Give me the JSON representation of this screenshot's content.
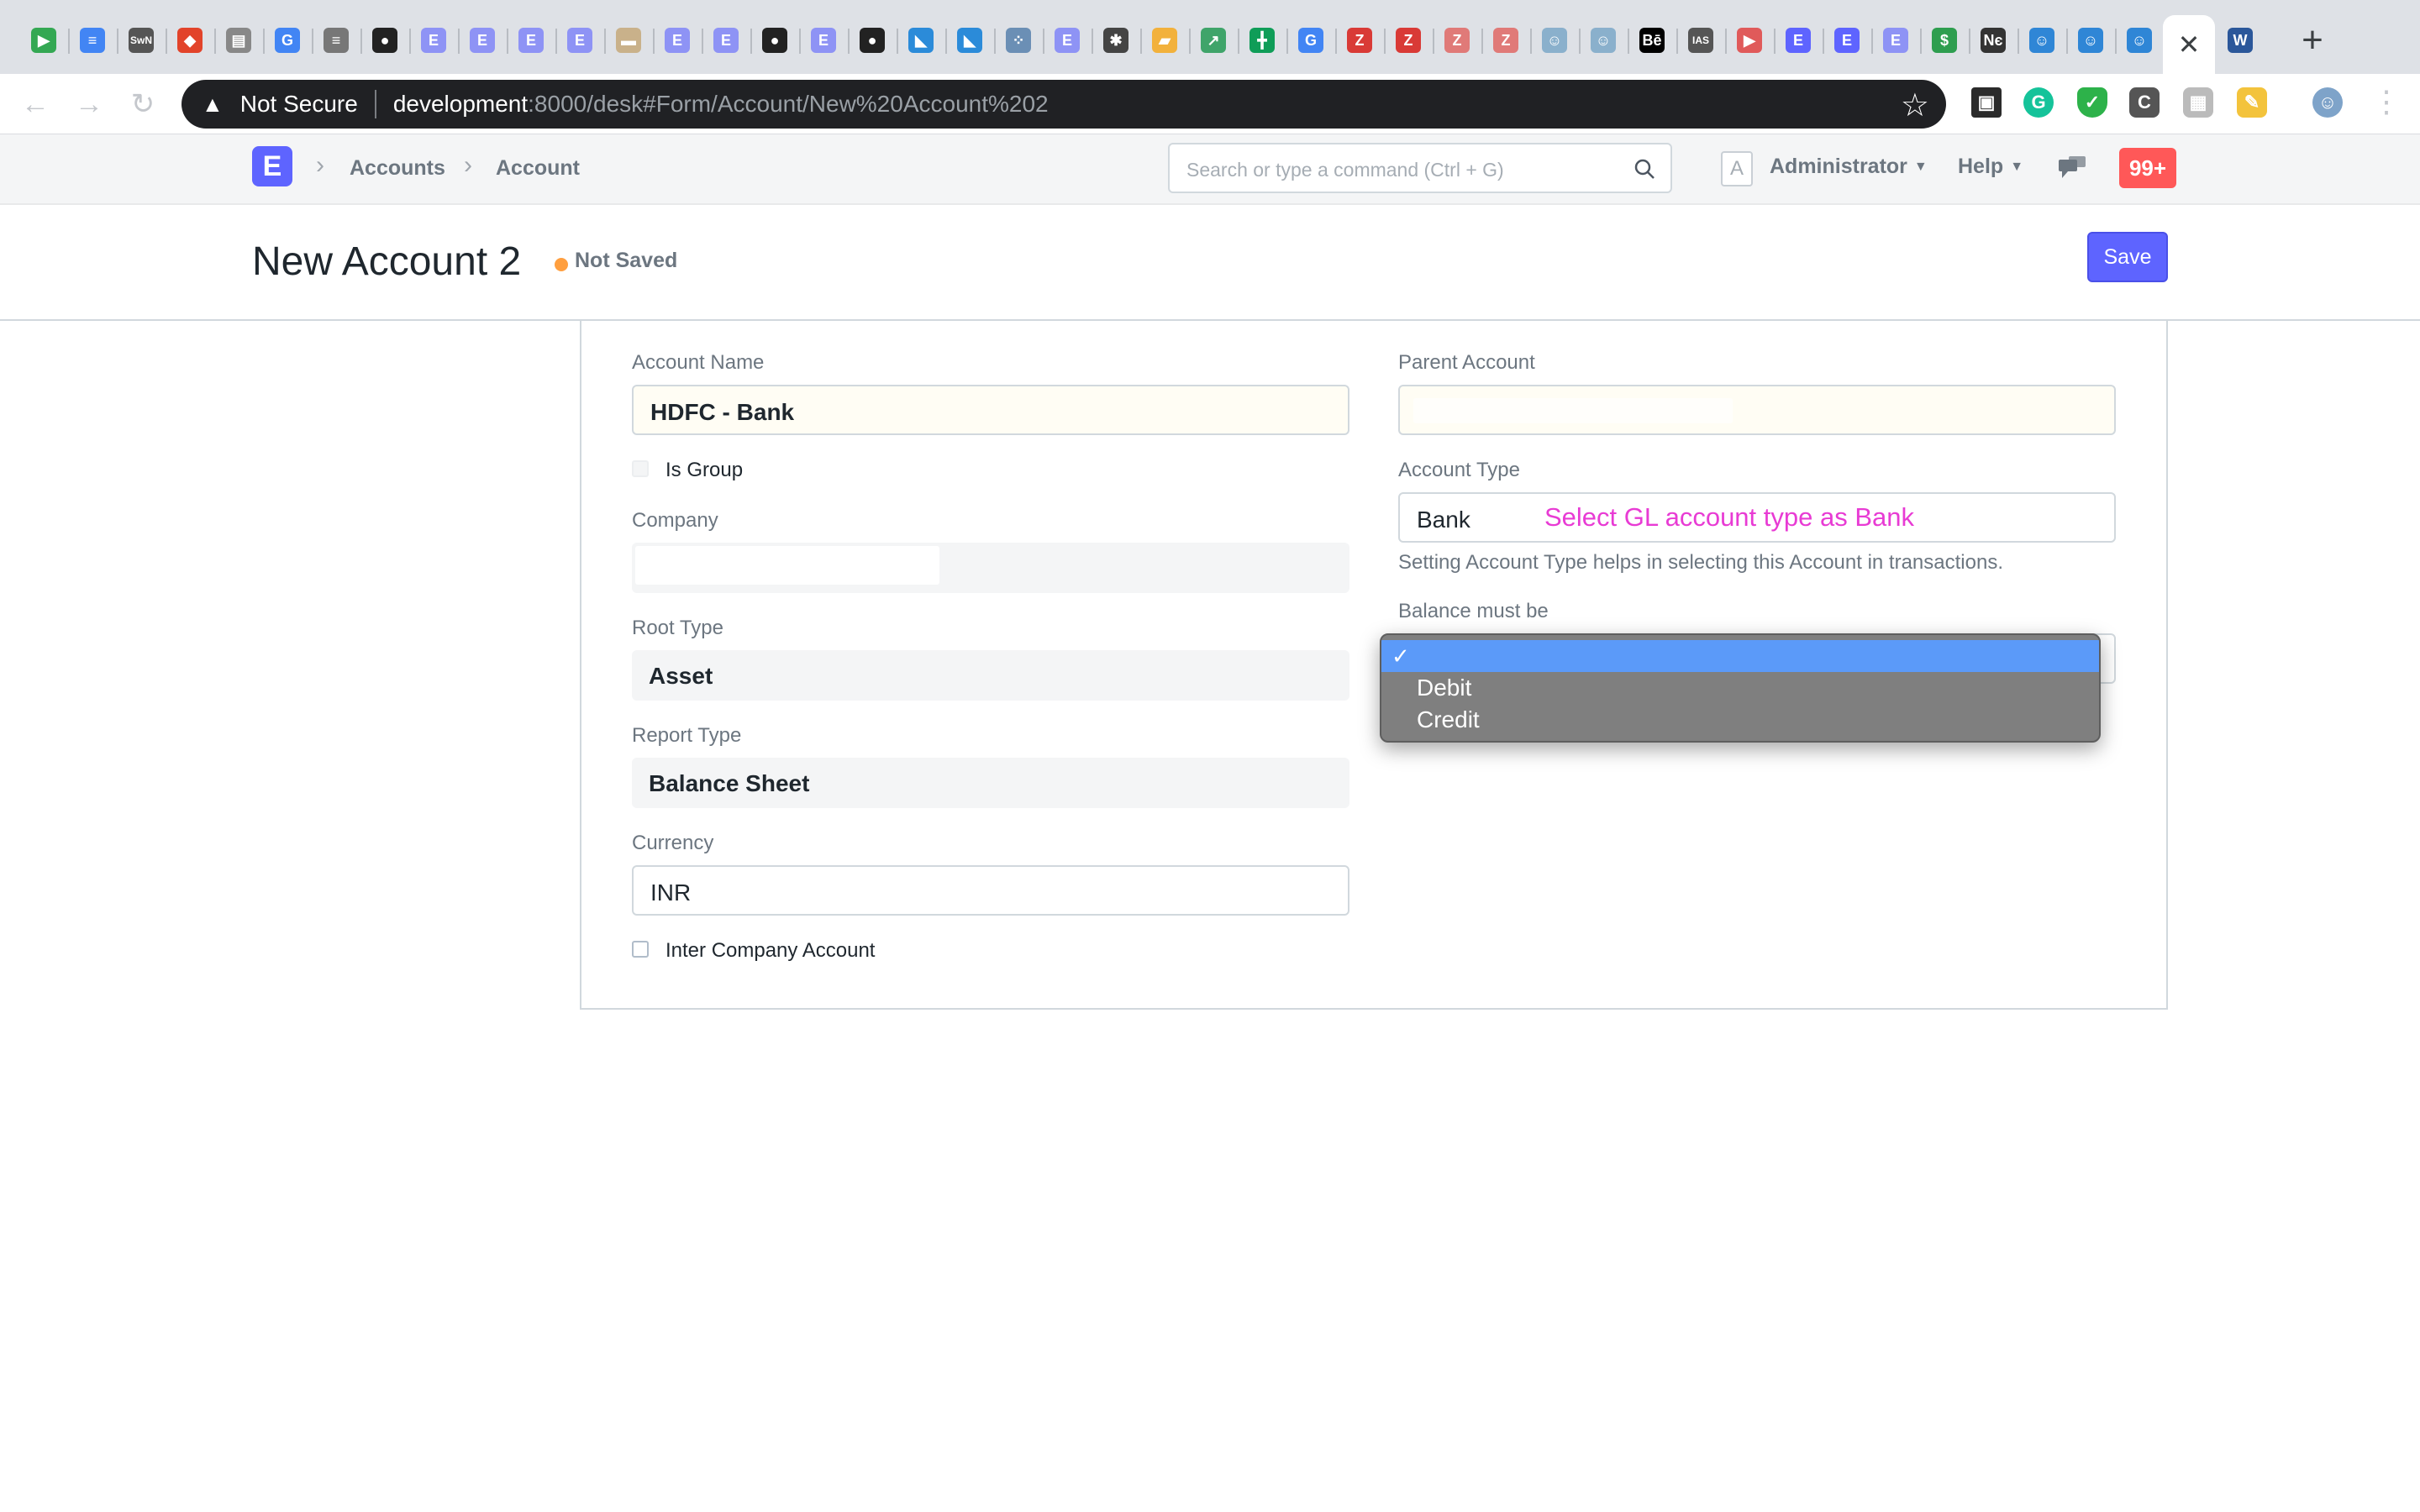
{
  "browser": {
    "active_tab_close": "✕",
    "new_tab": "+",
    "security_label": "Not Secure",
    "url_host": "development",
    "url_rest": ":8000/desk#Form/Account/New%20Account%202",
    "tabs": [
      {
        "icon": "play-store-icon",
        "glyph": "▶",
        "color": "#34a853"
      },
      {
        "icon": "docs-icon",
        "glyph": "≡",
        "color": "#4285f4"
      },
      {
        "icon": "swn-icon",
        "glyph": "SwN",
        "color": "#555555"
      },
      {
        "icon": "gitlab-icon",
        "glyph": "◆",
        "color": "#e2432a"
      },
      {
        "icon": "reader-icon",
        "glyph": "▤",
        "color": "#888888"
      },
      {
        "icon": "google-icon",
        "glyph": "G",
        "color": "#4285f4"
      },
      {
        "icon": "calc-icon",
        "glyph": "≡",
        "color": "#777777"
      },
      {
        "icon": "github-icon",
        "glyph": "●",
        "color": "#222222"
      },
      {
        "icon": "erpnext-icon",
        "glyph": "E",
        "color": "#8e93f5"
      },
      {
        "icon": "erpnext-icon",
        "glyph": "E",
        "color": "#8e93f5"
      },
      {
        "icon": "erpnext-icon",
        "glyph": "E",
        "color": "#8e93f5"
      },
      {
        "icon": "erpnext-icon",
        "glyph": "E",
        "color": "#8e93f5"
      },
      {
        "icon": "pdf-icon",
        "glyph": "▬",
        "color": "#c9b18a"
      },
      {
        "icon": "erpnext-icon",
        "glyph": "E",
        "color": "#8e93f5"
      },
      {
        "icon": "erpnext-icon",
        "glyph": "E",
        "color": "#8e93f5"
      },
      {
        "icon": "github-icon",
        "glyph": "●",
        "color": "#222222"
      },
      {
        "icon": "erpnext-icon",
        "glyph": "E",
        "color": "#8e93f5"
      },
      {
        "icon": "github-icon",
        "glyph": "●",
        "color": "#222222"
      },
      {
        "icon": "vscode-icon",
        "glyph": "◣",
        "color": "#2b8bd9"
      },
      {
        "icon": "vscode-icon",
        "glyph": "◣",
        "color": "#2b8bd9"
      },
      {
        "icon": "dots-icon",
        "glyph": "⁘",
        "color": "#6b8fb5"
      },
      {
        "icon": "erpnext-icon",
        "glyph": "E",
        "color": "#8e93f5"
      },
      {
        "icon": "puzzle-icon",
        "glyph": "✱",
        "color": "#444444"
      },
      {
        "icon": "slides-icon",
        "glyph": "▰",
        "color": "#f2b13c"
      },
      {
        "icon": "chart-icon",
        "glyph": "↗",
        "color": "#3fa46a"
      },
      {
        "icon": "sheets-icon",
        "glyph": "╋",
        "color": "#0f9d58"
      },
      {
        "icon": "google-icon",
        "glyph": "G",
        "color": "#4285f4"
      },
      {
        "icon": "zotero-icon",
        "glyph": "Z",
        "color": "#d93a36"
      },
      {
        "icon": "zotero-icon",
        "glyph": "Z",
        "color": "#d93a36"
      },
      {
        "icon": "zotero-icon",
        "glyph": "Z",
        "color": "#e07a78"
      },
      {
        "icon": "zotero-icon",
        "glyph": "Z",
        "color": "#e07a78"
      },
      {
        "icon": "octocat-icon",
        "glyph": "☺",
        "color": "#8ab0cc"
      },
      {
        "icon": "octocat-icon",
        "glyph": "☺",
        "color": "#8ab0cc"
      },
      {
        "icon": "behance-icon",
        "glyph": "Bē",
        "color": "#000000"
      },
      {
        "icon": "ias-icon",
        "glyph": "IAS",
        "color": "#555555"
      },
      {
        "icon": "youtube-icon",
        "glyph": "▶",
        "color": "#e05a5a"
      },
      {
        "icon": "erpnext-icon",
        "glyph": "E",
        "color": "#5e64ff"
      },
      {
        "icon": "erpnext-icon",
        "glyph": "E",
        "color": "#5e64ff"
      },
      {
        "icon": "erpnext-icon",
        "glyph": "E",
        "color": "#8e93f5"
      },
      {
        "icon": "dollar-icon",
        "glyph": "$",
        "color": "#2e9e4f"
      },
      {
        "icon": "netflix-icon",
        "glyph": "Nє",
        "color": "#333333"
      },
      {
        "icon": "octocat-icon",
        "glyph": "☺",
        "color": "#2f86d6"
      },
      {
        "icon": "octocat-icon",
        "glyph": "☺",
        "color": "#2f86d6"
      },
      {
        "icon": "octocat-icon",
        "glyph": "☺",
        "color": "#2f86d6"
      },
      {
        "icon": "word-icon",
        "glyph": "W",
        "color": "#2b579a"
      }
    ]
  },
  "navbar": {
    "logo": "E",
    "breadcrumbs": [
      "Accounts",
      "Account"
    ],
    "search_placeholder": "Search or type a command (Ctrl + G)",
    "avatar_letter": "A",
    "user": "Administrator",
    "help": "Help",
    "notifications": "99+"
  },
  "page": {
    "title": "New Account 2",
    "status": "Not Saved",
    "save_label": "Save"
  },
  "form": {
    "account_name_label": "Account Name",
    "account_name_value": "HDFC - Bank",
    "is_group_label": "Is Group",
    "company_label": "Company",
    "root_type_label": "Root Type",
    "root_type_value": "Asset",
    "report_type_label": "Report Type",
    "report_type_value": "Balance Sheet",
    "currency_label": "Currency",
    "currency_value": "INR",
    "inter_company_label": "Inter Company Account",
    "parent_account_label": "Parent Account",
    "account_type_label": "Account Type",
    "account_type_value": "Bank",
    "account_type_annotation": "Select GL account type as Bank",
    "account_type_hint": "Setting Account Type helps in selecting this Account in transactions.",
    "balance_label": "Balance must be",
    "balance_options": [
      "",
      "Debit",
      "Credit"
    ],
    "balance_check": "✓"
  },
  "colors": {
    "primary": "#5e64ff",
    "danger": "#ff5858",
    "warning_dot": "#ff9f3f",
    "annotation": "#e83bd4",
    "popup_highlight": "#5b9af9"
  }
}
